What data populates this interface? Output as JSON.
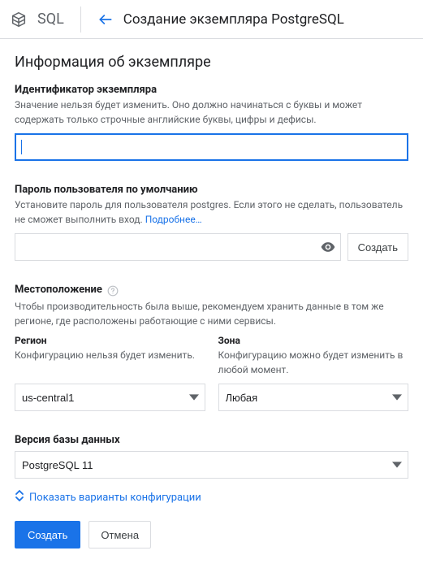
{
  "topbar": {
    "product": "SQL",
    "page_title": "Создание экземпляра PostgreSQL"
  },
  "section_title": "Информация об экземпляре",
  "instance_id": {
    "label": "Идентификатор экземпляра",
    "desc": "Значение нельзя будет изменить. Оно должно начинаться с буквы и может содержать только строчные английские буквы, цифры и дефисы.",
    "value": ""
  },
  "password": {
    "label": "Пароль пользователя по умолчанию",
    "desc_prefix": "Установите пароль для пользователя postgres. Если этого не сделать, пользователь не сможет выполнить вход. ",
    "learn_more": "Подробнее…",
    "value": "",
    "generate_label": "Создать"
  },
  "location": {
    "label": "Местоположение",
    "desc": "Чтобы производительность была выше, рекомендуем хранить данные в том же регионе, где расположены работающие с ними сервисы.",
    "region": {
      "label": "Регион",
      "desc": "Конфигурацию нельзя будет изменить.",
      "value": "us-central1"
    },
    "zone": {
      "label": "Зона",
      "desc": "Конфигурацию можно будет изменить в любой момент.",
      "value": "Любая"
    }
  },
  "db_version": {
    "label": "Версия базы данных",
    "value": "PostgreSQL 11"
  },
  "show_config_label": "Показать варианты конфигурации",
  "actions": {
    "create": "Создать",
    "cancel": "Отмена"
  }
}
